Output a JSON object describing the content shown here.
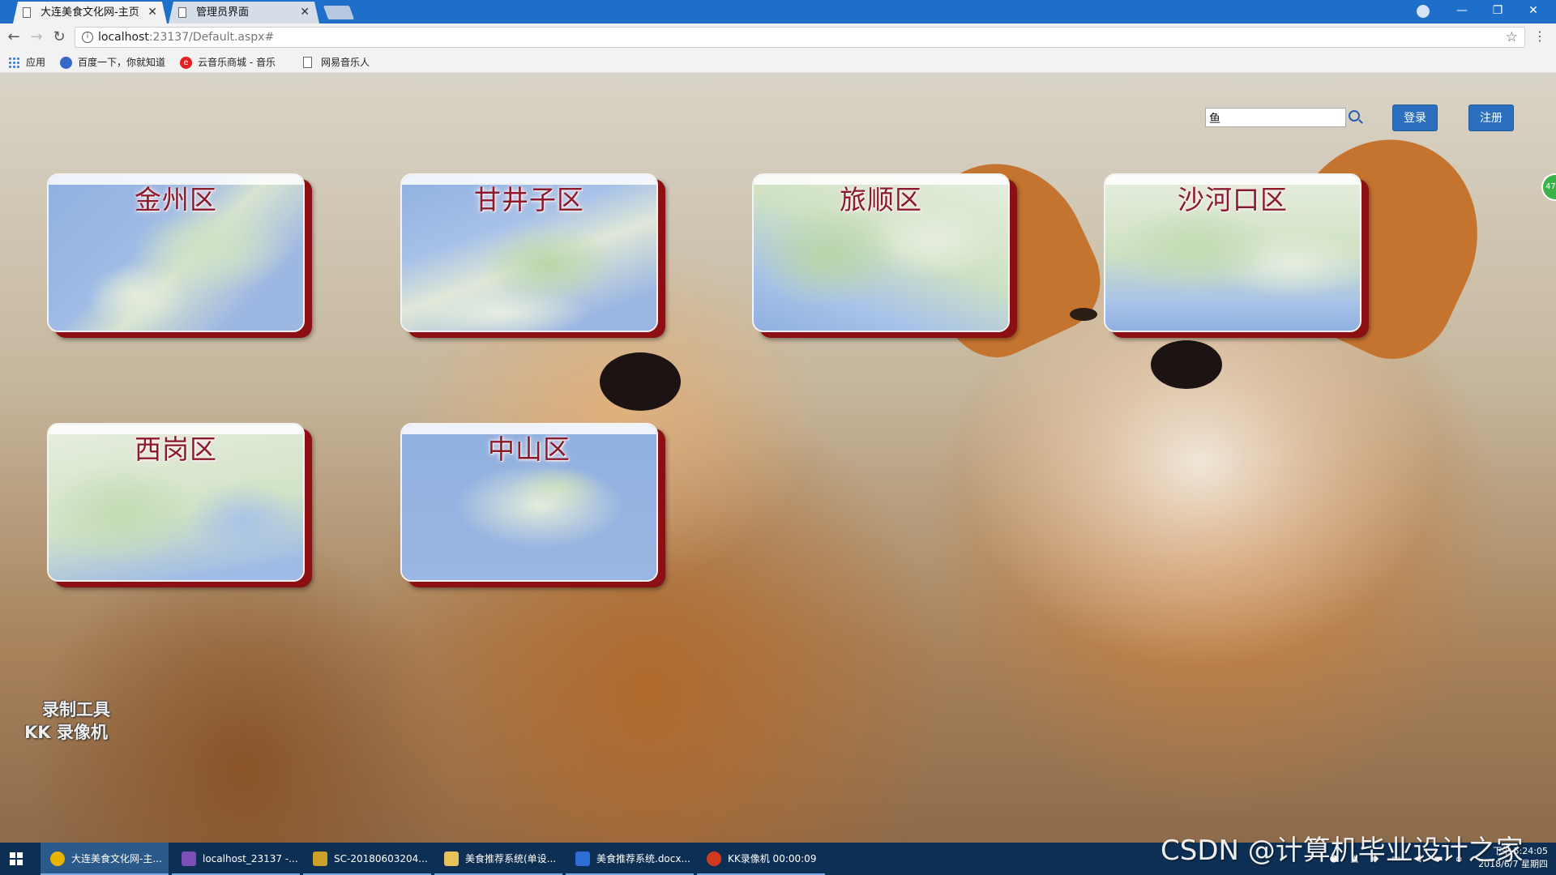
{
  "browser": {
    "tabs": [
      {
        "label": "大连美食文化网-主页",
        "active": true
      },
      {
        "label": "管理员界面",
        "active": false
      }
    ],
    "url_host": "localhost",
    "url_rest": ":23137/Default.aspx#",
    "bookmarks": [
      {
        "label": "应用",
        "icon": "apps-grid-icon"
      },
      {
        "label": "百度一下，你就知道",
        "icon": "baidu-paw-icon"
      },
      {
        "label": "云音乐商城 - 音乐",
        "icon": "netease-music-icon"
      },
      {
        "label": "网易音乐人",
        "icon": "page-icon"
      }
    ]
  },
  "header": {
    "search_value": "鱼",
    "login_label": "登录",
    "register_label": "注册"
  },
  "districts": [
    {
      "name": "金州区"
    },
    {
      "name": "甘井子区"
    },
    {
      "name": "旅顺区"
    },
    {
      "name": "沙河口区"
    },
    {
      "name": "西岗区"
    },
    {
      "name": "中山区"
    }
  ],
  "overlay": {
    "recorder_watermark_line1": "录制工具",
    "recorder_watermark_line2": "KK 录像机",
    "csdn_watermark": "CSDN @计算机毕业设计之家"
  },
  "taskbar": {
    "items": [
      {
        "label": "大连美食文化网-主...",
        "icon": "chrome-icon",
        "color": "#e8b400"
      },
      {
        "label": "localhost_23137 -...",
        "icon": "visual-studio-icon",
        "color": "#7b4fb6"
      },
      {
        "label": "SC-20180603204...",
        "icon": "tools-icon",
        "color": "#c9a227"
      },
      {
        "label": "美食推荐系统(单设...",
        "icon": "folder-icon",
        "color": "#e8c15a"
      },
      {
        "label": "美食推荐系统.docx...",
        "icon": "word-icon",
        "color": "#2b6fd6"
      },
      {
        "label": "KK录像机 00:00:09",
        "icon": "kk-recorder-icon",
        "color": "#d23a20"
      }
    ],
    "time": "下午 5:24:05",
    "date": "2018/6/7 星期四"
  },
  "colors": {
    "caption": "#8a1a2c",
    "card_shadow": "#8c0f14",
    "button": "#2c6fbe",
    "titlebar": "#1d6fc9"
  }
}
